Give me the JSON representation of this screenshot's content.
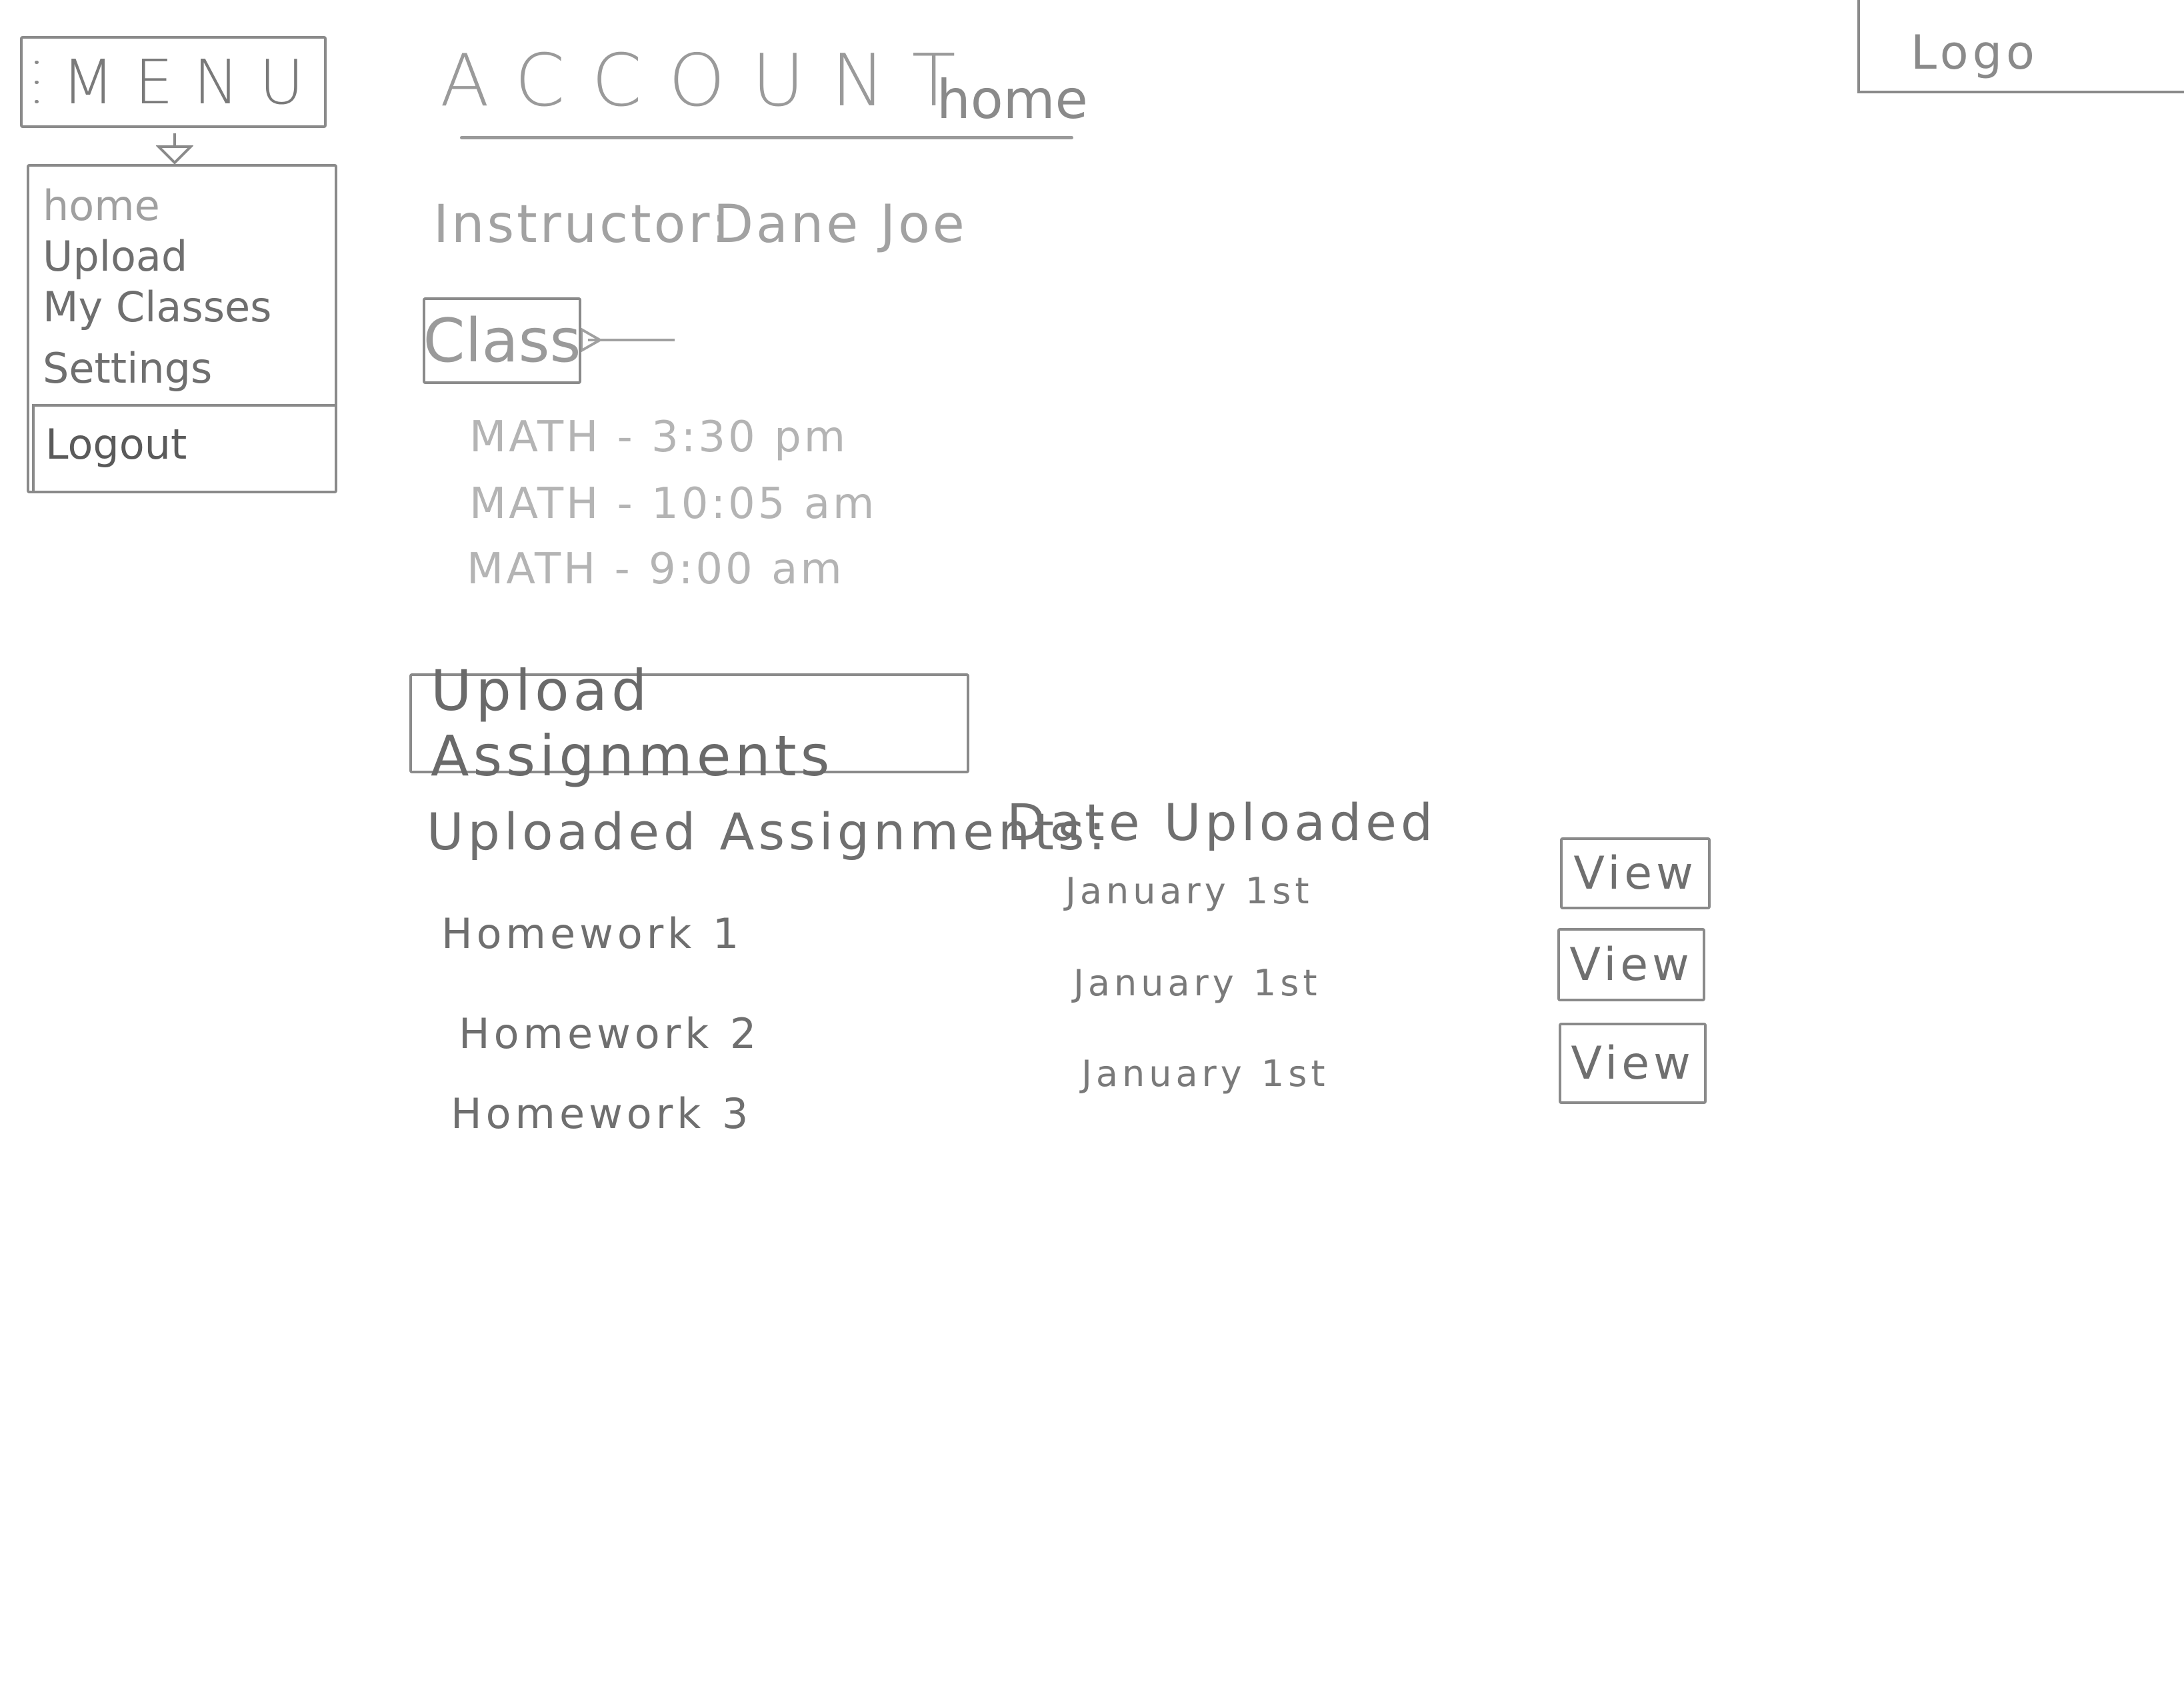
{
  "menu": {
    "label": "MENU",
    "items": [
      {
        "label": "home"
      },
      {
        "label": "Upload"
      },
      {
        "label": "My Classes"
      },
      {
        "label": "Settings"
      },
      {
        "label": "Logout"
      }
    ]
  },
  "header": {
    "title": "ACCOUNT",
    "subtitle": "home"
  },
  "logo": {
    "label": "Logo"
  },
  "instructor": {
    "label": "Instructor:",
    "name": "Dane Joe"
  },
  "class_selector": {
    "label": "Class",
    "items": [
      {
        "label": "MATH - 3:30 pm"
      },
      {
        "label": "MATH - 10:05 am"
      },
      {
        "label": "MATH - 9:00 am"
      }
    ]
  },
  "upload": {
    "button_label": "Upload Assignments"
  },
  "assignments": {
    "columns": {
      "name": "Uploaded Assignments:",
      "date": "Date Uploaded"
    },
    "rows": [
      {
        "name": "Homework 1",
        "date": "January 1st",
        "action": "View"
      },
      {
        "name": "Homework 2",
        "date": "January 1st",
        "action": "View"
      },
      {
        "name": "Homework 3",
        "date": "January 1st",
        "action": "View"
      }
    ]
  }
}
